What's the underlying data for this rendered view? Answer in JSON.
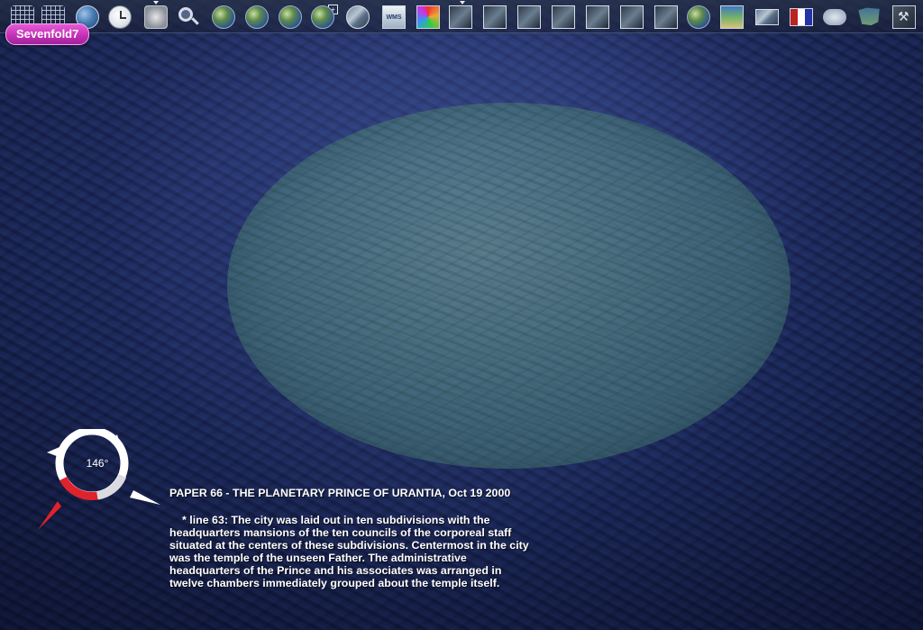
{
  "app": {
    "layer_badge": "Sevenfold7"
  },
  "toolbar": {
    "icons": [
      "layers-icon",
      "grid-icon",
      "globe-grid-icon",
      "clock-icon",
      "compass-tool-icon",
      "magnifier-icon",
      "earth-icon",
      "earth-icon",
      "earth-icon",
      "earth-icon",
      "satellite-image-icon",
      "wms-icon",
      "color-map-icon",
      "image-layer-icon",
      "image-layer-icon",
      "image-layer-icon",
      "image-layer-icon",
      "image-layer-icon",
      "image-layer-icon",
      "image-layer-icon",
      "image-layer-icon",
      "moon-globe-icon",
      "world-map-icon",
      "photos-icon",
      "flags-icon",
      "cloud-icon",
      "usa-map-icon",
      "tools-icon"
    ],
    "wms_label": "WMS"
  },
  "compass": {
    "heading": "146°"
  },
  "annotation": {
    "title": "PAPER 66 - THE PLANETARY PRINCE OF URANTIA, Oct 19 2000",
    "body": "* line 63: The city was laid out in ten subdivisions with the headquarters mansions of the ten councils of the corporeal staff situated at the centers of these subdivisions. Centermost in the city was the temple of the unseen Father. The administrative headquarters of the Prince and his associates was arranged in twelve chambers immediately grouped about the temple itself."
  },
  "colors": {
    "badge": "#c12fb3",
    "placemark_fill": "#5f9a8c",
    "compass_red": "#e0222a"
  }
}
